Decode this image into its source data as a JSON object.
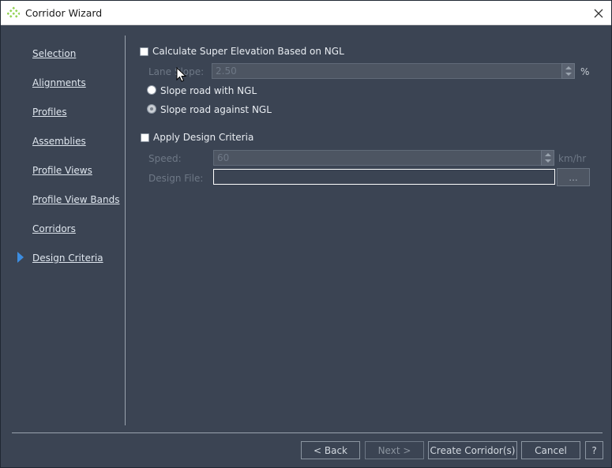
{
  "window": {
    "title": "Corridor Wizard",
    "accent_icon_color": "#8fd14f"
  },
  "sidebar": {
    "items": [
      {
        "label": "Selection"
      },
      {
        "label": "Alignments"
      },
      {
        "label": "Profiles"
      },
      {
        "label": "Assemblies"
      },
      {
        "label": "Profile Views"
      },
      {
        "label": "Profile View Bands"
      },
      {
        "label": "Corridors"
      },
      {
        "label": "Design Criteria",
        "active": true
      }
    ],
    "active_arrow_color": "#3c8de0"
  },
  "super_elevation": {
    "checkbox_label": "Calculate Super Elevation Based on NGL",
    "checked": false,
    "lane_slope_label": "Lane Slope:",
    "lane_slope_value": "2.50",
    "lane_slope_unit": "%",
    "radio_with": "Slope road with NGL",
    "radio_against": "Slope road against NGL",
    "selected": "against"
  },
  "design_criteria": {
    "checkbox_label": "Apply Design Criteria",
    "checked": false,
    "speed_label": "Speed:",
    "speed_value": "60",
    "speed_unit": "km/hr",
    "design_file_label": "Design File:",
    "design_file_value": "",
    "browse_label": "..."
  },
  "footer": {
    "back_label": "< Back",
    "next_label": "Next >",
    "create_label": "Create Corridor(s)",
    "cancel_label": "Cancel",
    "help_label": "?"
  }
}
